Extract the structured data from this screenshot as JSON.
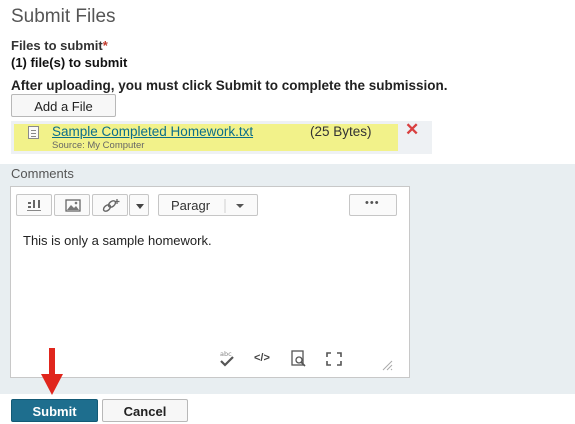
{
  "page": {
    "title": "Submit Files"
  },
  "files": {
    "label": "Files to submit",
    "required_marker": "*",
    "count_text": "(1) file(s) to submit",
    "instruction": "After uploading, you must click Submit to complete the submission.",
    "add_file_label": "Add a File",
    "items": [
      {
        "name": "Sample Completed Homework.txt",
        "size": "(25 Bytes)",
        "source": "Source: My Computer"
      }
    ]
  },
  "comments": {
    "label": "Comments",
    "format_value": "Paragr",
    "more_label": "•••",
    "content": "This is only a sample homework.",
    "source_code_label": "</>"
  },
  "actions": {
    "submit_label": "Submit",
    "cancel_label": "Cancel"
  },
  "colors": {
    "accent": "#1e6e8e",
    "highlight": "#f2f28a",
    "remove": "#d94040",
    "arrow": "#e0261d"
  }
}
